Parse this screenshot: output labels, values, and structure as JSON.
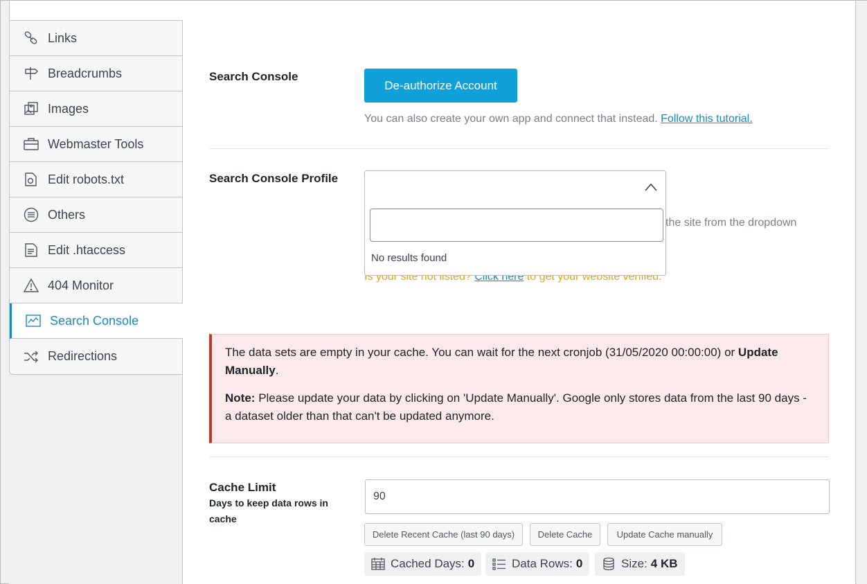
{
  "sidebar": {
    "items": [
      {
        "label": "Links",
        "icon": "link-icon"
      },
      {
        "label": "Breadcrumbs",
        "icon": "signpost-icon"
      },
      {
        "label": "Images",
        "icon": "images-icon"
      },
      {
        "label": "Webmaster Tools",
        "icon": "toolbox-icon"
      },
      {
        "label": "Edit robots.txt",
        "icon": "robot-file-icon"
      },
      {
        "label": "Others",
        "icon": "list-circle-icon"
      },
      {
        "label": "Edit .htaccess",
        "icon": "file-icon"
      },
      {
        "label": "404 Monitor",
        "icon": "warning-icon"
      },
      {
        "label": "Search Console",
        "icon": "chart-icon",
        "active": true
      },
      {
        "label": "Redirections",
        "icon": "shuffle-icon"
      }
    ]
  },
  "search_console": {
    "label": "Search Console",
    "deauth_button": "De-authorize Account",
    "help_text": "You can also create your own app and connect that instead.",
    "help_link": "Follow this tutorial."
  },
  "profile": {
    "label": "Search Console Profile",
    "dropdown_empty": "No results found",
    "behind_text": "the site from the dropdown",
    "verify_prefix": "Is your site not listed?",
    "verify_link": "Click here",
    "verify_suffix": "to get your website verified."
  },
  "notice": {
    "text1": "The data sets are empty in your cache. You can wait for the next cronjob (31/05/2020 00:00:00) or",
    "text1_bold": "Update Manually",
    "text1_end": ".",
    "note_label": "Note:",
    "note_text": "Please update your data by clicking on 'Update Manually'. Google only stores data from the last 90 days - a dataset older than that can't be updated anymore."
  },
  "cache": {
    "label": "Cache Limit",
    "description": "Days to keep data rows in cache",
    "value": "90",
    "buttons": {
      "delete_recent": "Delete Recent Cache (last 90 days)",
      "delete": "Delete Cache",
      "update": "Update Cache manually"
    },
    "stats": {
      "cached_days_label": "Cached Days:",
      "cached_days_value": "0",
      "data_rows_label": "Data Rows:",
      "data_rows_value": "0",
      "size_label": "Size:",
      "size_value": "4 KB"
    }
  },
  "colors": {
    "accent": "#10a1db",
    "active_nav": "#1a8bb5",
    "notice_bg": "#fce9e9",
    "notice_border": "#c0392b",
    "verify_text": "#dba617"
  }
}
